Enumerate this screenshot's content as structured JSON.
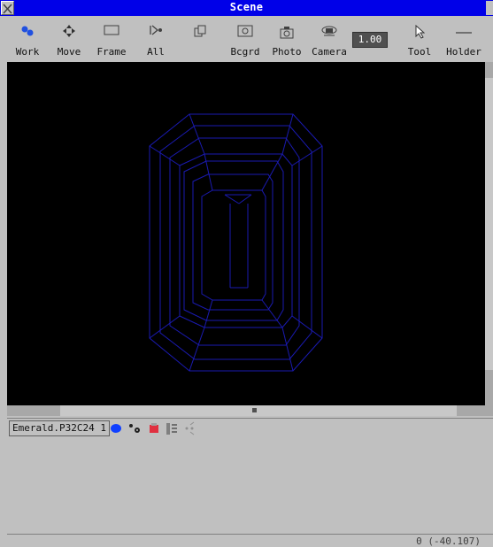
{
  "window": {
    "title": "Scene"
  },
  "toolbar": {
    "items": [
      {
        "label": "Work",
        "icon": "work-icon"
      },
      {
        "label": "Move",
        "icon": "move-icon"
      },
      {
        "label": "Frame",
        "icon": "frame-icon"
      },
      {
        "label": "All",
        "icon": "all-icon"
      },
      {
        "label": "",
        "icon": "pages-icon"
      },
      {
        "label": "Bcgrd",
        "icon": "background-icon"
      },
      {
        "label": "Photo",
        "icon": "photo-icon"
      },
      {
        "label": "Camera",
        "icon": "camera-icon"
      },
      {
        "label": "Tool",
        "icon": "pointer-icon"
      },
      {
        "label": "Holder",
        "icon": "holder-icon"
      }
    ],
    "zoom_value": "1.00",
    "colors": {
      "highlight": "#c8b400",
      "title_bar": "#0000e8",
      "wireframe": "#1a1ab0"
    }
  },
  "panel": {
    "object_name": "Emerald.P32C24 1"
  },
  "statusbar": {
    "coords": "0 (-40.107)"
  }
}
